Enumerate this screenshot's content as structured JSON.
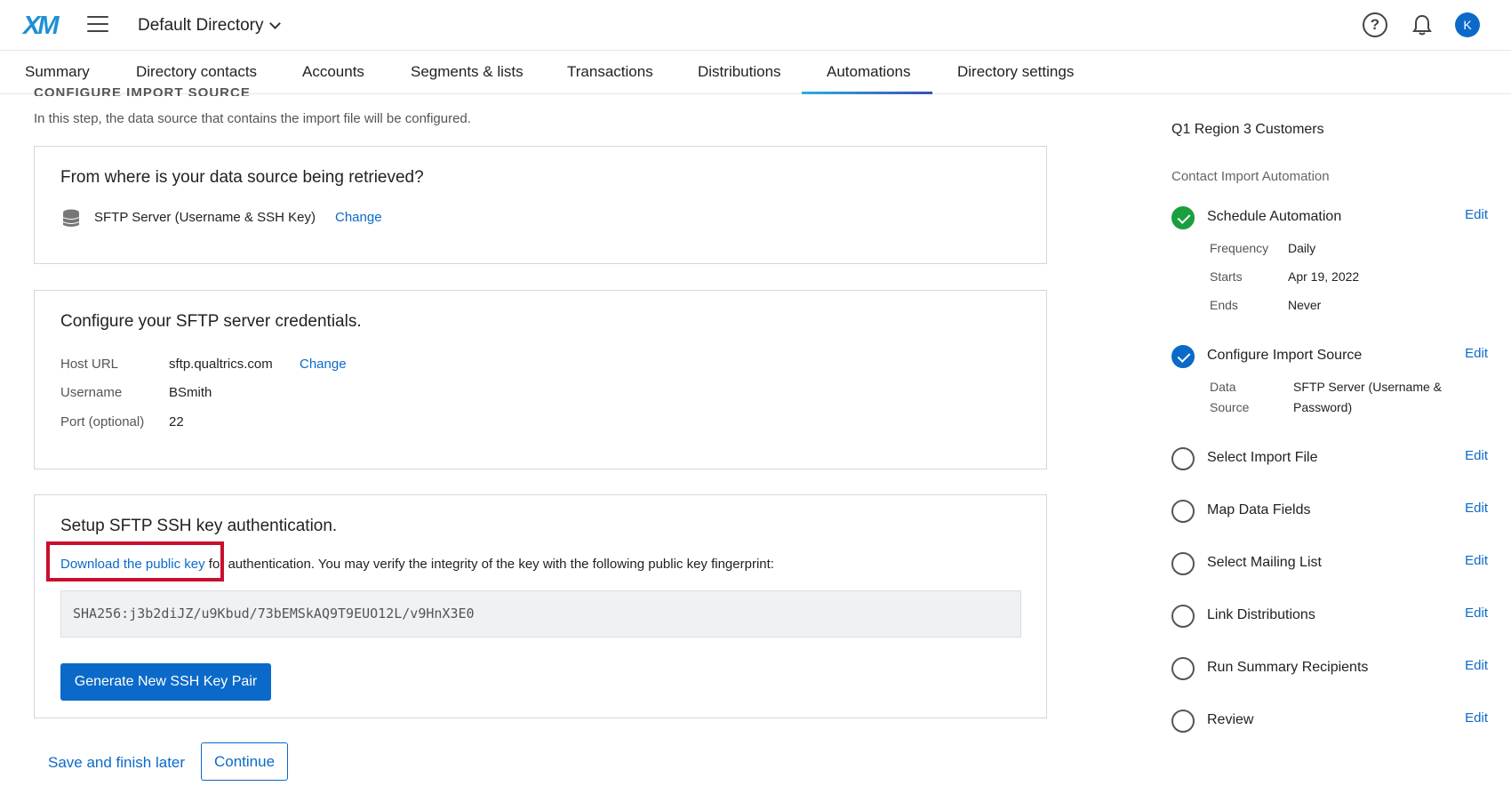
{
  "header": {
    "logo": "XM",
    "directory": "Default Directory",
    "avatar_initial": "K"
  },
  "tabs": [
    {
      "label": "Summary"
    },
    {
      "label": "Directory contacts"
    },
    {
      "label": "Accounts"
    },
    {
      "label": "Segments & lists"
    },
    {
      "label": "Transactions"
    },
    {
      "label": "Distributions"
    },
    {
      "label": "Automations",
      "active": true
    },
    {
      "label": "Directory settings"
    }
  ],
  "main": {
    "cutoff_heading": "CONFIGURE IMPORT SOURCE",
    "step_description": "In this step, the data source that contains the import file will be configured.",
    "source_card": {
      "title": "From where is your data source being retrieved?",
      "source": "SFTP Server (Username & SSH Key)",
      "change_label": "Change"
    },
    "credentials_card": {
      "title": "Configure your SFTP server credentials.",
      "host_label": "Host URL",
      "host_value": "sftp.qualtrics.com",
      "change_label": "Change",
      "username_label": "Username",
      "username_value": "BSmith",
      "port_label": "Port (optional)",
      "port_value": "22"
    },
    "ssh_card": {
      "title": "Setup SFTP SSH key authentication.",
      "download_link": "Download the public key",
      "download_rest": " for authentication. You may verify the integrity of the key with the following public key fingerprint:",
      "fingerprint": "SHA256:j3b2diJZ/u9Kbud/73bEMSkAQ9T9EUO12L/v9HnX3E0",
      "generate_button": "Generate New SSH Key Pair"
    },
    "footer": {
      "save_later": "Save and finish later",
      "continue": "Continue"
    }
  },
  "sidebar": {
    "title": "Q1 Region 3 Customers",
    "subtitle": "Contact Import Automation",
    "edit_label": "Edit",
    "steps": [
      {
        "name": "Schedule Automation",
        "status": "complete",
        "color": "#1a9e3f"
      },
      {
        "name": "Configure Import Source",
        "status": "current",
        "color": "#0b6ac9"
      },
      {
        "name": "Select Import File",
        "status": "pending"
      },
      {
        "name": "Map Data Fields",
        "status": "pending"
      },
      {
        "name": "Select Mailing List",
        "status": "pending"
      },
      {
        "name": "Link Distributions",
        "status": "pending"
      },
      {
        "name": "Run Summary Recipients",
        "status": "pending"
      },
      {
        "name": "Review",
        "status": "pending"
      }
    ],
    "schedule_details": {
      "frequency_label": "Frequency",
      "frequency_value": "Daily",
      "starts_label": "Starts",
      "starts_value": "Apr 19, 2022",
      "ends_label": "Ends",
      "ends_value": "Never"
    },
    "source_details": {
      "label_line1": "Data",
      "label_line2": "Source",
      "value_line1": "SFTP Server (Username &",
      "value_line2": "Password)"
    }
  }
}
